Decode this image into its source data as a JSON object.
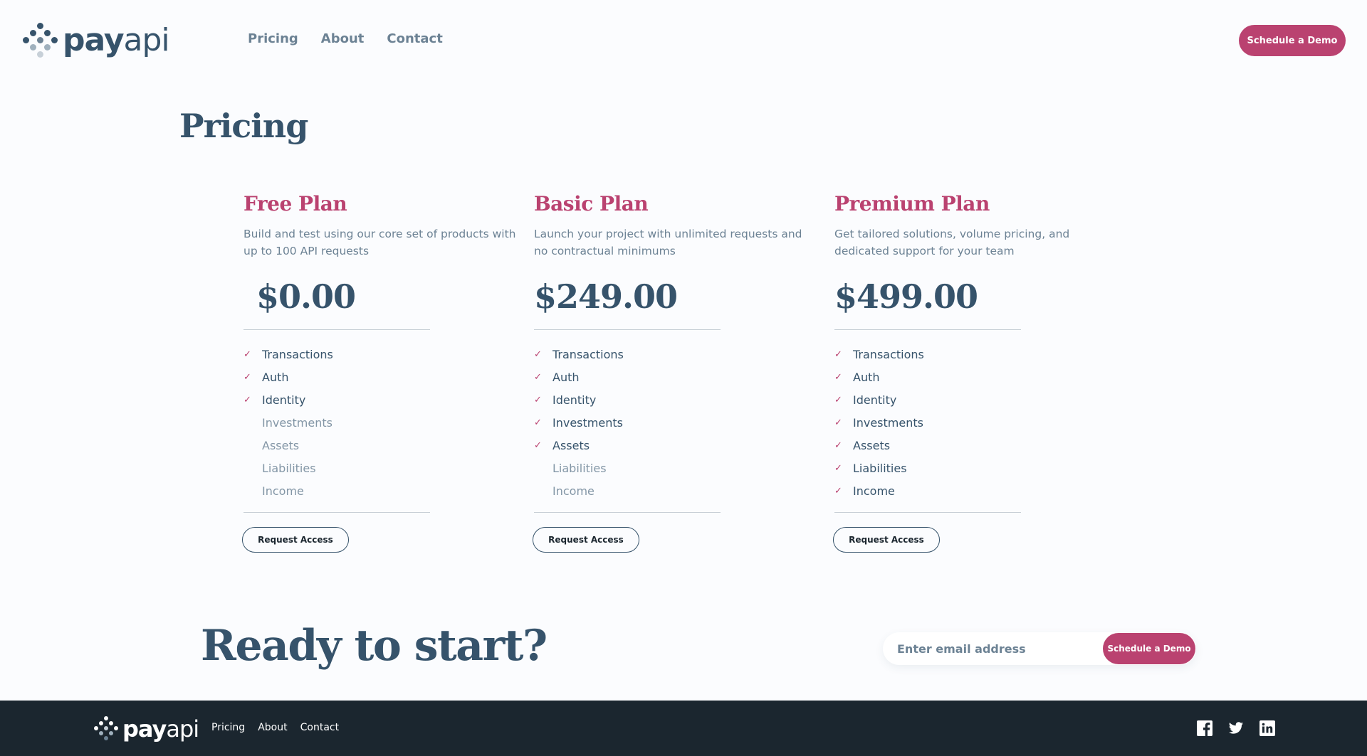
{
  "brand": {
    "logo_pay": "pay",
    "logo_api": "api"
  },
  "nav": {
    "pricing": "Pricing",
    "about": "About",
    "contact": "Contact"
  },
  "header": {
    "demo_label": "Schedule a Demo"
  },
  "page": {
    "title": "Pricing"
  },
  "plans": [
    {
      "name": "Free Plan",
      "description": "Build and test using our core set of products with up to 100 API requests",
      "price": "$0.00",
      "features": [
        {
          "label": "Transactions",
          "included": true
        },
        {
          "label": "Auth",
          "included": true
        },
        {
          "label": "Identity",
          "included": true
        },
        {
          "label": "Investments",
          "included": false
        },
        {
          "label": "Assets",
          "included": false
        },
        {
          "label": "Liabilities",
          "included": false
        },
        {
          "label": "Income",
          "included": false
        }
      ],
      "button": "Request Access"
    },
    {
      "name": "Basic Plan",
      "description": "Launch your project with unlimited requests and no contractual minimums",
      "price": "$249.00",
      "features": [
        {
          "label": "Transactions",
          "included": true
        },
        {
          "label": "Auth",
          "included": true
        },
        {
          "label": "Identity",
          "included": true
        },
        {
          "label": "Investments",
          "included": true
        },
        {
          "label": "Assets",
          "included": true
        },
        {
          "label": "Liabilities",
          "included": false
        },
        {
          "label": "Income",
          "included": false
        }
      ],
      "button": "Request Access"
    },
    {
      "name": "Premium Plan",
      "description": "Get tailored solutions, volume pricing, and dedicated support for your team",
      "price": "$499.00",
      "features": [
        {
          "label": "Transactions",
          "included": true
        },
        {
          "label": "Auth",
          "included": true
        },
        {
          "label": "Identity",
          "included": true
        },
        {
          "label": "Investments",
          "included": true
        },
        {
          "label": "Assets",
          "included": true
        },
        {
          "label": "Liabilities",
          "included": true
        },
        {
          "label": "Income",
          "included": true
        }
      ],
      "button": "Request Access"
    }
  ],
  "cta": {
    "title": "Ready to start?",
    "email_placeholder": "Enter email address",
    "button": "Schedule a Demo"
  },
  "footer": {
    "links": {
      "pricing": "Pricing",
      "about": "About",
      "contact": "Contact"
    },
    "socials": [
      "facebook-icon",
      "twitter-icon",
      "linkedin-icon"
    ]
  },
  "colors": {
    "accent": "#BA4270",
    "primary_text": "#36536B",
    "muted_text": "#6C8294",
    "background": "#FBFCFE",
    "footer_bg": "#1B262F"
  }
}
